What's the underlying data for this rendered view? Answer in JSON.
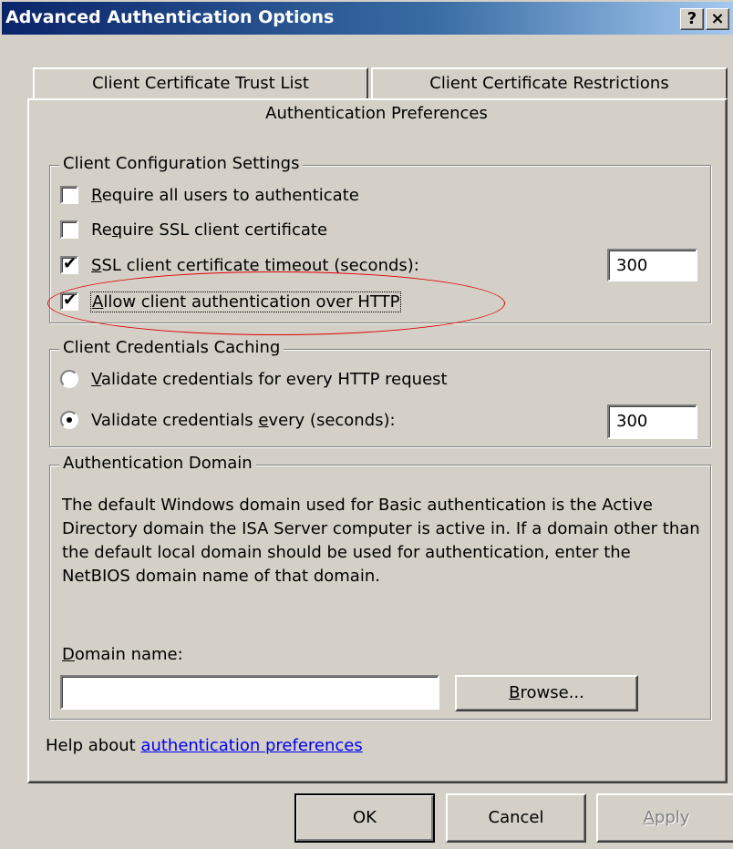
{
  "window": {
    "title": "Advanced Authentication Options",
    "help_button": "?",
    "close_button": "×"
  },
  "tabs": [
    {
      "label": "Client Certificate Trust List",
      "selected": false
    },
    {
      "label": "Client Certificate Restrictions",
      "selected": false
    },
    {
      "label": "Authentication Preferences",
      "selected": true
    }
  ],
  "client_config": {
    "legend": "Client Configuration Settings",
    "require_all": {
      "accel": "R",
      "rest": "equire all users to authenticate",
      "checked": false
    },
    "require_ssl": {
      "pre": "Re",
      "accel": "q",
      "rest": "uire SSL client certificate",
      "checked": false
    },
    "ssl_timeout": {
      "accel": "S",
      "rest": "SL client certificate timeout (seconds):",
      "checked": true,
      "value": "300"
    },
    "allow_http": {
      "accel": "A",
      "rest": "llow client authentication over HTTP",
      "checked": true
    }
  },
  "credentials_caching": {
    "legend": "Client Credentials Caching",
    "validate_every_request": {
      "accel": "V",
      "rest": "alidate credentials for every HTTP request",
      "selected": false
    },
    "validate_every_seconds": {
      "pre": "Validate credentials ",
      "accel": "e",
      "rest": "very (seconds):",
      "selected": true,
      "value": "300"
    }
  },
  "auth_domain": {
    "legend": "Authentication Domain",
    "description": "The default Windows domain used for Basic authentication is the Active Directory domain the ISA Server computer is active in. If a domain other than the default local domain should be used for authentication, enter the NetBIOS domain name of that domain.",
    "domain_label_accel": "D",
    "domain_label_rest": "omain name:",
    "domain_value": "",
    "browse_accel": "B",
    "browse_rest": "rowse..."
  },
  "help": {
    "prefix": "Help about ",
    "link": "authentication preferences"
  },
  "buttons": {
    "ok": "OK",
    "cancel": "Cancel",
    "apply_accel": "A",
    "apply_rest": "pply"
  },
  "colors": {
    "dialog_face": "#d4d0c8",
    "title_start": "#0a246a",
    "title_end": "#a6caf0",
    "link": "#0000ee",
    "annotation": "#e00000"
  }
}
